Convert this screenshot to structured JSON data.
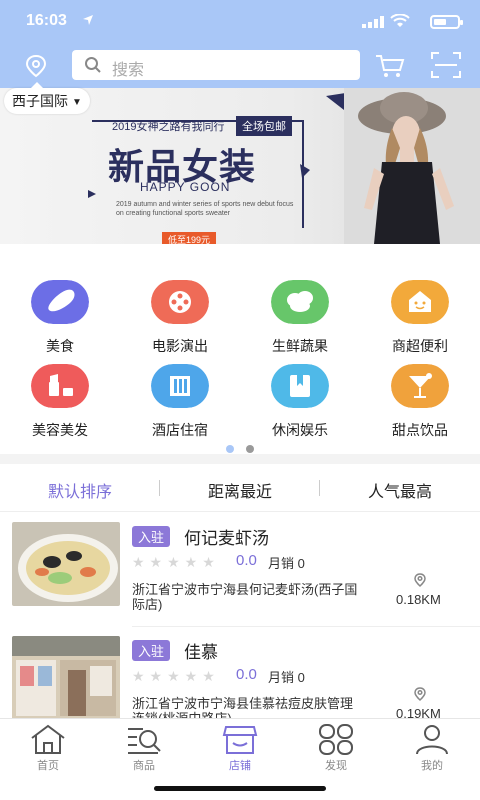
{
  "status_bar": {
    "time": "16:03"
  },
  "header": {
    "search_placeholder": "搜索",
    "city": "西子国际",
    "colors": {
      "header_bg": "#a9c7f7",
      "accent": "#7b6fd8"
    }
  },
  "banner": {
    "tagline": "2019女神之路有我同行",
    "badge": "全场包邮",
    "title": "新品女装",
    "subtitle_en": "HAPPY GOON",
    "small_text": "2019 autumn and winter series of sports new debut focus on creating functional sports sweater",
    "price_tag": "低至199元"
  },
  "categories": [
    {
      "label": "美食",
      "icon": "bread-icon",
      "color": "#6c6ee6"
    },
    {
      "label": "电影演出",
      "icon": "film-reel-icon",
      "color": "#ef6b57"
    },
    {
      "label": "生鲜蔬果",
      "icon": "vegetable-icon",
      "color": "#67c66a"
    },
    {
      "label": "商超便利",
      "icon": "shop-icon",
      "color": "#f2a93b"
    },
    {
      "label": "美容美发",
      "icon": "lipstick-icon",
      "color": "#ef5b5b"
    },
    {
      "label": "酒店住宿",
      "icon": "hotel-icon",
      "color": "#4ea6ea"
    },
    {
      "label": "休闲娱乐",
      "icon": "bookmark-icon",
      "color": "#4fb9e8"
    },
    {
      "label": "甜点饮品",
      "icon": "cocktail-icon",
      "color": "#f0a23c"
    }
  ],
  "carousel": {
    "pages": 2,
    "active": 1
  },
  "sort_tabs": [
    {
      "label": "默认排序",
      "active": true
    },
    {
      "label": "距离最近",
      "active": false
    },
    {
      "label": "人气最高",
      "active": false
    }
  ],
  "stores": [
    {
      "tag": "入驻",
      "name": "何记麦虾汤",
      "stars": "★★★★★",
      "rating": "0.0",
      "sales": "月销 0",
      "address": "浙江省宁波市宁海县何记麦虾汤(西子国际店)",
      "distance": "0.18KM"
    },
    {
      "tag": "入驻",
      "name": "佳慕",
      "stars": "★★★★★",
      "rating": "0.0",
      "sales": "月销 0",
      "address": "浙江省宁波市宁海县佳慕祛痘皮肤管理连锁(桃源中路店)",
      "distance": "0.19KM"
    }
  ],
  "tabbar": [
    {
      "label": "首页",
      "icon": "home-icon",
      "active": false
    },
    {
      "label": "商品",
      "icon": "product-search-icon",
      "active": false
    },
    {
      "label": "店铺",
      "icon": "store-icon",
      "active": true
    },
    {
      "label": "发现",
      "icon": "discover-icon",
      "active": false
    },
    {
      "label": "我的",
      "icon": "profile-icon",
      "active": false
    }
  ]
}
